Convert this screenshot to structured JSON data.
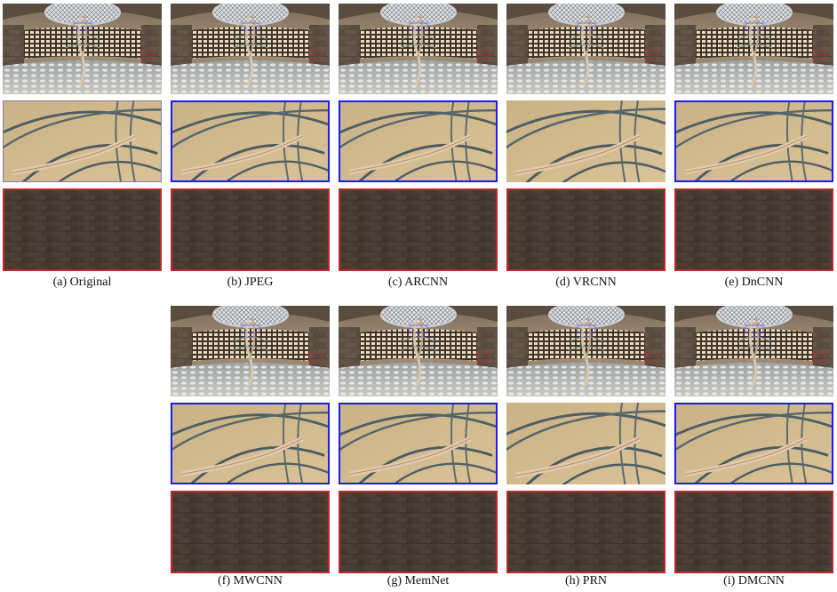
{
  "figure": {
    "panels": [
      {
        "id": "a",
        "caption": "(a)  Original",
        "crop_border_top": "none"
      },
      {
        "id": "b",
        "caption": "(b)  JPEG",
        "crop_border_top": "blue"
      },
      {
        "id": "c",
        "caption": "(c)  ARCNN",
        "crop_border_top": "blue"
      },
      {
        "id": "d",
        "caption": "(d)  VRCNN",
        "crop_border_top": "none"
      },
      {
        "id": "e",
        "caption": "(e)  DnCNN",
        "crop_border_top": "blue"
      },
      {
        "id": "f",
        "caption": "(f)  MWCNN",
        "crop_border_top": "blue"
      },
      {
        "id": "g",
        "caption": "(g)  MemNet",
        "crop_border_top": "blue"
      },
      {
        "id": "h",
        "caption": "(h)  PRN",
        "crop_border_top": "none"
      },
      {
        "id": "i",
        "caption": "(i)  DMCNN",
        "crop_border_top": "blue"
      }
    ],
    "colors": {
      "blue_box": "#1a1aff",
      "red_box": "#c0272d"
    }
  }
}
